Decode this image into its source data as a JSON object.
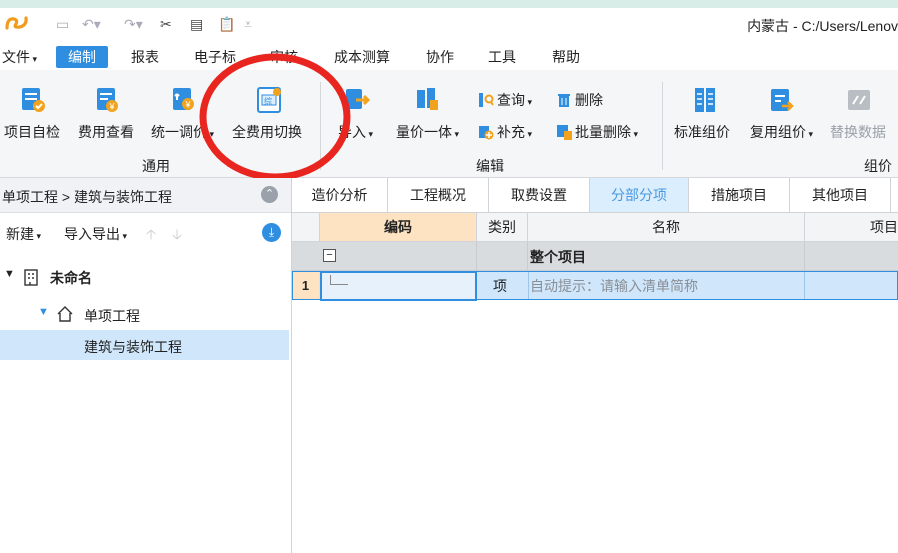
{
  "title_bar": {
    "window_title": "内蒙古 - C:/Users/Lenov",
    "quick_access": [
      "save-icon",
      "undo-icon",
      "redo-icon",
      "cut-icon",
      "copy-icon",
      "paste-icon",
      "customize-icon"
    ]
  },
  "menu": {
    "items": [
      "文件",
      "编制",
      "报表",
      "电子标",
      "审核",
      "成本测算",
      "协作",
      "工具",
      "帮助"
    ],
    "active": "编制",
    "file_label": "文件"
  },
  "ribbon": {
    "general": {
      "label": "通用",
      "buttons": [
        "项目自检",
        "费用查看",
        "统一调价",
        "全费用切换"
      ]
    },
    "edit": {
      "label": "编辑",
      "import": "导入",
      "quantity": "量价一体",
      "query": "查询",
      "supplement": "补充",
      "delete": "删除",
      "batch_delete": "批量删除"
    },
    "pricing": {
      "label": "组价",
      "buttons": [
        "标准组价",
        "复用组价",
        "替换数据"
      ]
    }
  },
  "left_panel": {
    "breadcrumb": "单项工程 > 建筑与装饰工程",
    "toolbar": {
      "new": "新建",
      "import_export": "导入导出"
    },
    "tree": {
      "root": "未命名",
      "child": "单项工程",
      "leaf": "建筑与装饰工程"
    }
  },
  "tabs": [
    "造价分析",
    "工程概况",
    "取费设置",
    "分部分项",
    "措施项目",
    "其他项目"
  ],
  "active_tab": "分部分项",
  "grid": {
    "headers": {
      "code": "编码",
      "type": "类别",
      "name": "名称",
      "item": "项目"
    },
    "group_row": {
      "toggle": "−",
      "name": "整个项目"
    },
    "rows": [
      {
        "num": "1",
        "code": "",
        "type": "项",
        "name": "自动提示：请输入清单简称"
      }
    ]
  },
  "colors": {
    "accent": "#2f8ee0",
    "selection": "#cfe6fb",
    "annotation_circle": "#e8261f"
  }
}
